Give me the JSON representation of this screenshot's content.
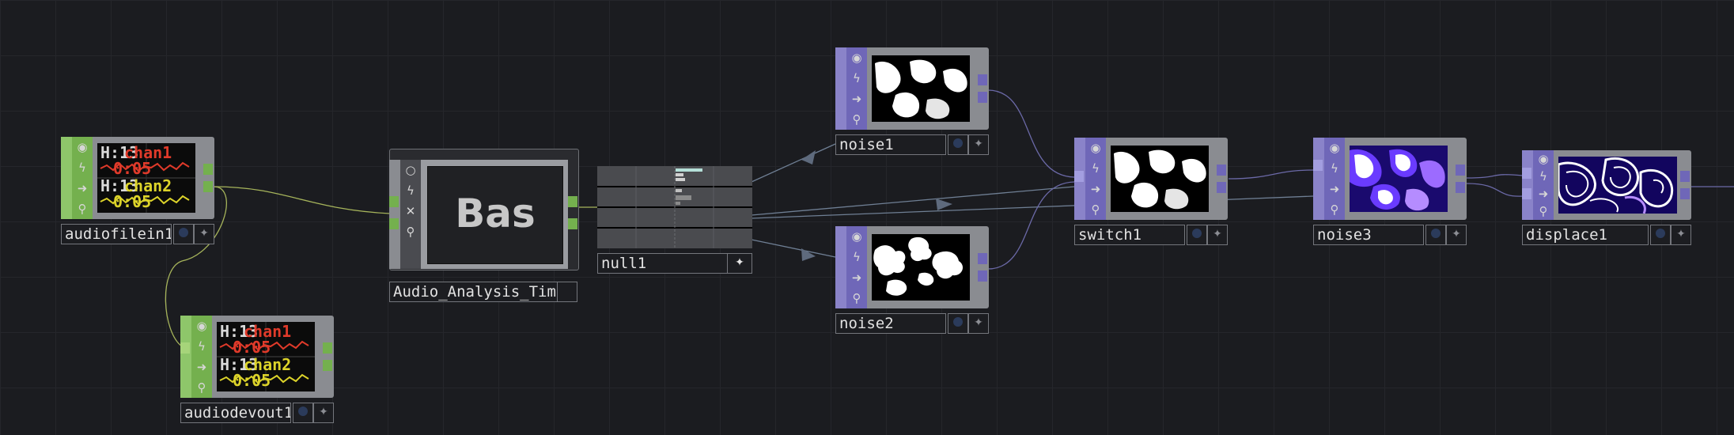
{
  "network": {
    "nodes": {
      "audiofilein1": {
        "name": "audiofilein1",
        "family": "CHOP",
        "channels": [
          "chan1",
          "chan2"
        ],
        "readouts": [
          "H:13",
          "0:05"
        ]
      },
      "audiodevout1": {
        "name": "audiodevout1",
        "family": "CHOP",
        "channels": [
          "chan1",
          "chan2"
        ],
        "readouts": [
          "H:13",
          "0:05"
        ]
      },
      "base": {
        "name": "Audio_Analysis_Time",
        "preview_text": "Bas",
        "family": "COMP"
      },
      "null1": {
        "name": "null1",
        "family": "CHOP"
      },
      "noise1": {
        "name": "noise1",
        "family": "TOP"
      },
      "noise2": {
        "name": "noise2",
        "family": "TOP"
      },
      "switch1": {
        "name": "switch1",
        "family": "TOP"
      },
      "noise3": {
        "name": "noise3",
        "family": "TOP"
      },
      "displace1": {
        "name": "displace1",
        "family": "TOP"
      }
    },
    "icons": {
      "bypass": "circle-dot-icon",
      "lock": "lightning-icon",
      "display": "arrow-right-icon",
      "cooking": "wrench-icon",
      "viewer": "star-icon"
    },
    "colors": {
      "background": "#1b1c20",
      "chop_accent": "#74b04e",
      "top_accent": "#6f67b8",
      "comp_accent": "#8a8c91",
      "wire_top": "#6b69a7",
      "wire_chop": "#a6b45b",
      "wire_null": "#6f7f94",
      "chan1": "#e03a2a",
      "chan2": "#dcd32a"
    }
  }
}
